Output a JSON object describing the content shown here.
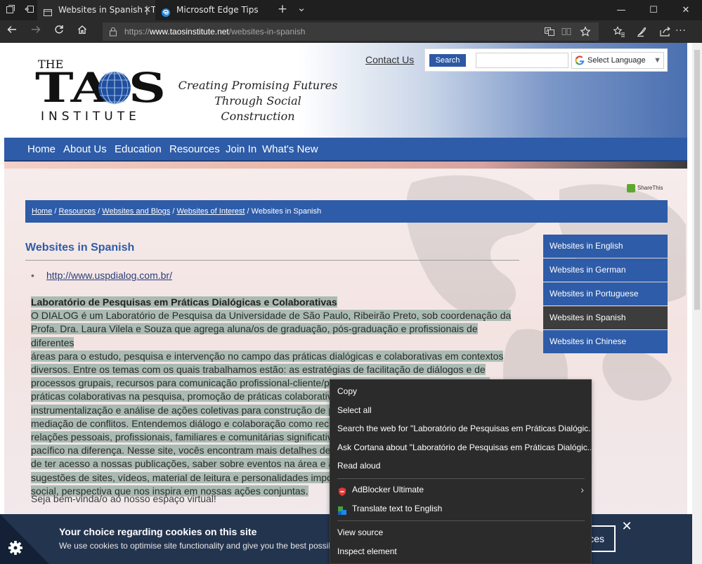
{
  "browser": {
    "tabs": [
      {
        "label": "Websites in Spanish | Th",
        "active": true
      },
      {
        "label": "Microsoft Edge Tips",
        "active": false
      }
    ],
    "new_tab_symbol": "+",
    "tab_list_symbol": "⌄",
    "window_controls": {
      "minimize": "—",
      "maximize": "☐",
      "close": "✕"
    },
    "url": {
      "scheme": "https://",
      "host": "www.taosinstitute.net",
      "path": "/websites-in-spanish"
    },
    "more_symbol": "···"
  },
  "site": {
    "logo": {
      "line1": "THE",
      "word": "TA  S",
      "line3": "INSTITUTE"
    },
    "tagline": [
      "Creating Promising Futures",
      "Through Social Construction"
    ],
    "contact_label": "Contact Us",
    "search_button": "Search",
    "search_value": "",
    "language_select": "Select Language",
    "nav": [
      "Home",
      "About Us",
      "Education",
      "Resources",
      "Join In",
      "What's New"
    ],
    "share_label": "ShareThis",
    "breadcrumb": [
      {
        "label": "Home",
        "link": true
      },
      {
        "label": "Resources",
        "link": true
      },
      {
        "label": "Websites and Blogs",
        "link": true
      },
      {
        "label": "Websites of Interest",
        "link": true
      },
      {
        "label": "Websites in Spanish",
        "link": false
      }
    ],
    "page_title": "Websites in Spanish",
    "bullet_symbol": "•",
    "bullet_link": "http://www.uspdialog.com.br/",
    "article_heading": "Laboratório de Pesquisas em Práticas Dialógicas e Colaborativas",
    "article_lines": [
      "O DIALOG é um Laboratório de Pesquisa da Universidade de São Paulo, Ribeirão Preto, sob coordenação da",
      "Profa. Dra. Laura Vilela e Souza que agrega aluna/os de graduação, pós-graduação e profissionais de diferentes",
      "áreas para o estudo, pesquisa e intervenção no campo das práticas dialógicas e colaborativas em contextos",
      "diversos. Entre os temas com os quais trabalhamos estão: as estratégias de facilitação de diálogos e de",
      "processos grupais, recursos para comunicação profissional-cliente/profissional-profissional, promoção de",
      "práticas colaborativas na pesquisa, promoção de práticas colaborativ",
      "instrumentalização e análise de ações coletivas para construção de p",
      "mediação de conflitos. Entendemos diálogo e colaboração como recu",
      "relações pessoais, profissionais, familiares e comunitárias significativ",
      "pacífico na diferença. Nesse site, vocês encontram mais detalhes de",
      "de ter acesso a nossas publicações, saber sobre eventos na área e ap",
      "sugestões de sites, vídeos, material de leitura e personalidades impo",
      "social, perspectiva que nos inspira em nossas ações conjuntas."
    ],
    "welcome": "Seja bem-vinda/o ao nosso espaço virtual!",
    "sidenav": [
      {
        "label": "Websites in English",
        "active": false
      },
      {
        "label": "Websites in German",
        "active": false
      },
      {
        "label": "Websites in Portuguese",
        "active": false
      },
      {
        "label": "Websites in Spanish",
        "active": true
      },
      {
        "label": "Websites in Chinese",
        "active": false
      }
    ]
  },
  "cookie": {
    "title": "Your choice regarding cookies on this site",
    "text": "We use cookies to optimise site functionality and give you the best possil",
    "button_label": "ces",
    "close_symbol": "✕"
  },
  "context_menu": {
    "items": [
      {
        "label": "Copy"
      },
      {
        "label": "Select all"
      },
      {
        "label": "Search the web for \"Laboratório de Pesquisas em Práticas Dialógic...\""
      },
      {
        "label": "Ask Cortana about \"Laboratório de Pesquisas em Práticas Dialógic...\""
      },
      {
        "label": "Read aloud"
      },
      {
        "label": "AdBlocker Ultimate",
        "icon": "adblocker-icon",
        "submenu": true
      },
      {
        "label": "Translate text to English",
        "icon": "translator-icon"
      },
      {
        "label": "View source"
      },
      {
        "label": "Inspect element"
      }
    ],
    "submenu_symbol": "›"
  },
  "colors": {
    "site_blue": "#2e5ca8",
    "active_side_item": "#3d3d3d",
    "selection_highlight": "#aabbb3",
    "cookie_bar": "#23344f",
    "context_menu_bg": "#2b2b2b"
  }
}
